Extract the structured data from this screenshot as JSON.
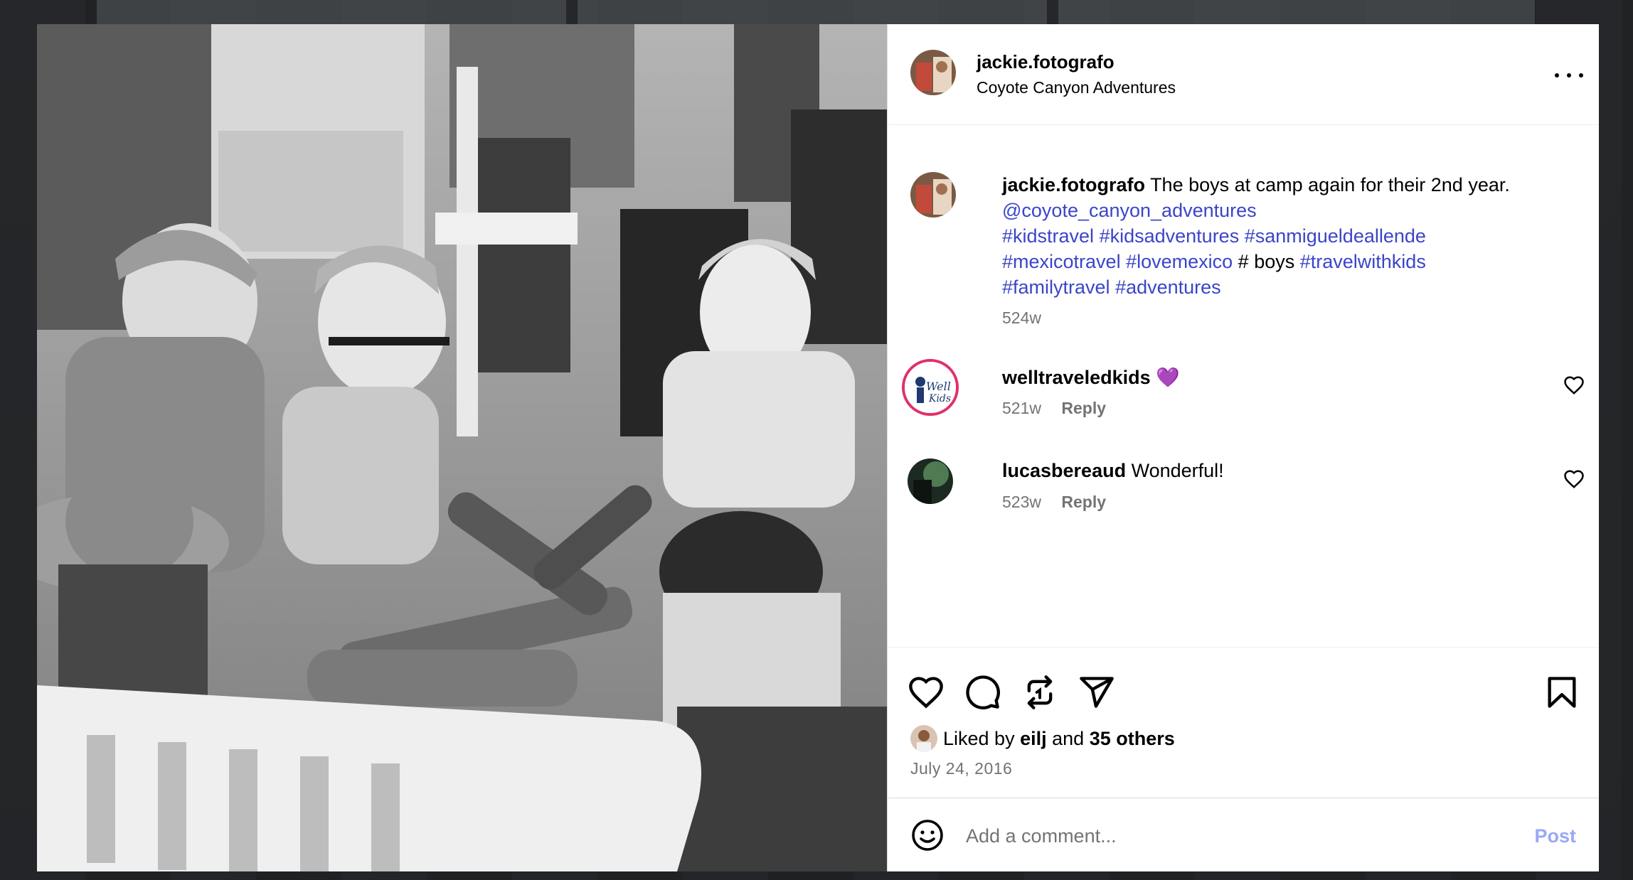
{
  "post": {
    "username": "jackie.fotografo",
    "location": "Coyote Canyon Adventures",
    "photo_alt": "Black and white photo of boys sitting around a campfire"
  },
  "caption": {
    "username": "jackie.fotografo",
    "text": "The boys at camp again for their 2nd year.",
    "mention": "@coyote_canyon_adventures",
    "tags_line1": [
      "#kidstravel",
      "#kidsadventures",
      "#sanmigueldeallende"
    ],
    "tags_line2_a": [
      "#mexicotravel",
      "#lovemexico"
    ],
    "plain_word": "# boys",
    "tags_line2_b": [
      "#travelwithkids"
    ],
    "tags_line3": [
      "#familytravel",
      "#adventures"
    ],
    "age": "524w"
  },
  "comments": [
    {
      "username": "welltraveledkids",
      "text": "💜",
      "age": "521w",
      "reply_label": "Reply"
    },
    {
      "username": "lucasbereaud",
      "text": "Wonderful!",
      "age": "523w",
      "reply_label": "Reply"
    }
  ],
  "likes": {
    "prefix": "Liked by",
    "user": "eilj",
    "joiner": "and",
    "others": "35 others"
  },
  "date": "July 24, 2016",
  "comment_box": {
    "placeholder": "Add a comment...",
    "post_label": "Post"
  },
  "icons": {
    "more": "more-options-icon",
    "like": "heart-icon",
    "comment": "comment-icon",
    "repost": "repost-icon",
    "share": "share-icon",
    "save": "bookmark-icon",
    "emoji": "emoji-icon"
  },
  "colors": {
    "link": "#3a45c9",
    "muted": "#737373",
    "post_button": "#9aa8f7",
    "story_ring": "#e1306c"
  }
}
